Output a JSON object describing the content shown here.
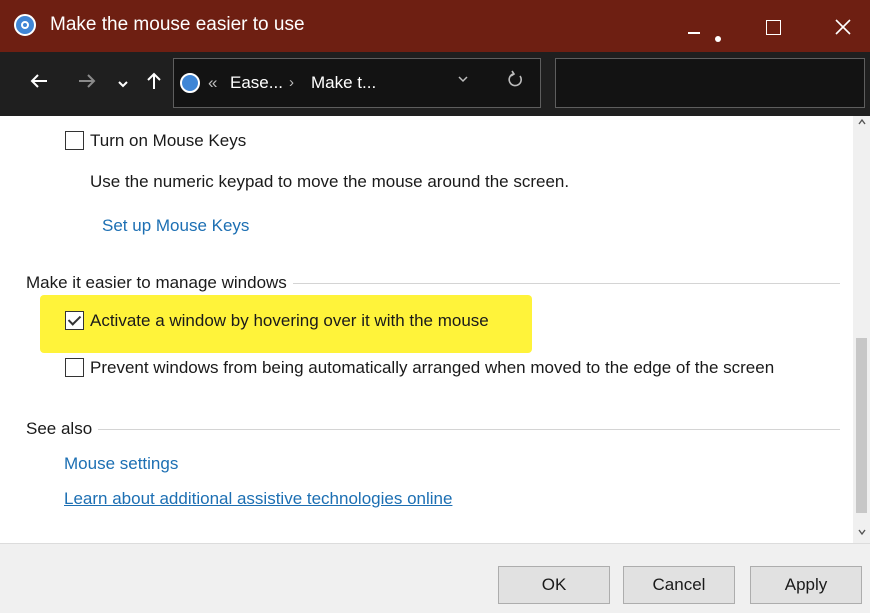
{
  "window": {
    "title": "Make the mouse easier to use"
  },
  "address_bar": {
    "overflow": "«",
    "crumbs": [
      "Ease...",
      "Make t..."
    ],
    "separator": "›"
  },
  "content": {
    "mouse_keys": {
      "checkbox_label": "Turn on Mouse Keys",
      "checked": false,
      "description": "Use the numeric keypad to move the mouse around the screen.",
      "setup_link": "Set up Mouse Keys"
    },
    "manage_windows": {
      "heading": "Make it easier to manage windows",
      "hover_activate": {
        "label": "Activate a window by hovering over it with the mouse",
        "checked": true,
        "highlight_color": "#fff33a"
      },
      "prevent_arrange": {
        "label": "Prevent windows from being automatically arranged when moved to the edge of the screen",
        "checked": false
      }
    },
    "see_also": {
      "heading": "See also",
      "links": [
        "Mouse settings",
        "Learn about additional assistive technologies online"
      ]
    }
  },
  "footer": {
    "ok": "OK",
    "cancel": "Cancel",
    "apply": "Apply"
  },
  "colors": {
    "titlebar": "#6e1f12",
    "navbar": "#1f1f1f",
    "link": "#1c6fb3"
  },
  "icons": [
    "ease-of-access-icon",
    "back-arrow-icon",
    "forward-arrow-icon",
    "recent-dropdown-icon",
    "up-arrow-icon",
    "refresh-icon",
    "minimize-icon",
    "maximize-icon",
    "close-icon"
  ]
}
